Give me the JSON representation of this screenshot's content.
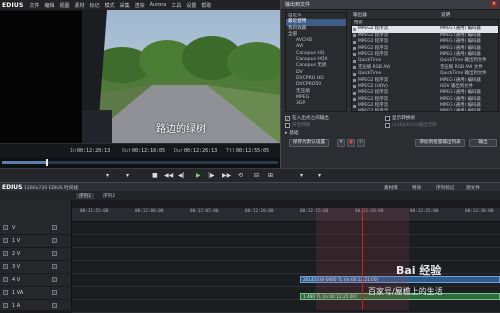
{
  "app": {
    "name": "EDIUS"
  },
  "menu": [
    "文件",
    "编辑",
    "视图",
    "素材",
    "标记",
    "模式",
    "采集",
    "渲染",
    "Aurora",
    "工具",
    "设置",
    "帮助"
  ],
  "preview": {
    "subtitle": "路边的绿树"
  },
  "timecodes": [
    {
      "label": "In",
      "value": "00:12:20:13"
    },
    {
      "label": "Out",
      "value": "00:12:16:05"
    },
    {
      "label": "Dur",
      "value": "00:12:26:13"
    },
    {
      "label": "Ttl",
      "value": "00:12:55:05"
    }
  ],
  "scrub_progress": 0.16,
  "dialog": {
    "title": "输出到文件",
    "tree": [
      "自定义",
      "最近使用",
      "我的收藏",
      "全部",
      "AVCHD",
      "AVI",
      "Canopus HQ",
      "Canopus HQX",
      "Canopus 无损",
      "DV",
      "DVCPRO HD",
      "DVCPRO50",
      "无压缩",
      "MPEG",
      "3GP"
    ],
    "tree_selected": 1,
    "col_output": "输出器",
    "col_desc": "说明",
    "search_label": "搜索",
    "rows": [
      {
        "name": "MPEG2 程序流",
        "desc": "MPEG (通用) 编码器"
      },
      {
        "name": "MPEG2 程序流",
        "desc": "MPEG (通用) 编码器"
      },
      {
        "name": "MPEG2 程序流",
        "desc": "MPEG (通用) 编码器"
      },
      {
        "name": "MPEG2 程序流",
        "desc": "MPEG (通用) 编码器"
      },
      {
        "name": "MPEG2 程序流",
        "desc": "MPEG (通用) 编码器"
      },
      {
        "name": "QuickTime",
        "desc": "QuickTime 输出到文件"
      },
      {
        "name": "无压缩 RGB AVI",
        "desc": "无压缩 RGB AVI 文件"
      },
      {
        "name": "QuickTime",
        "desc": "QuickTime 输出到文件"
      },
      {
        "name": "MPEG2 程序流",
        "desc": "MPEG (通用) 编码器"
      },
      {
        "name": "MPEG2 (HDV)",
        "desc": "HDV 输出到文件"
      },
      {
        "name": "MPEG2 程序流",
        "desc": "MPEG (通用) 编码器"
      },
      {
        "name": "MPEG2 程序流",
        "desc": "MPEG (通用) 编码器"
      },
      {
        "name": "MPEG2 程序流",
        "desc": "MPEG (通用) 编码器"
      },
      {
        "name": "MPEG2 程序流",
        "desc": "MPEG (通用) 编码器"
      }
    ],
    "row_selected": 0,
    "opt_inout": "在入出点之间输出",
    "opt_convert": "显示转换帧",
    "opt_field": "开启转换",
    "opt_reverse": "以16bit/2ch输出音频",
    "opt_basic": "基础",
    "btn_save_default": "保存为默认设置",
    "btn_add": "添加到批量输出列表",
    "btn_output": "输出"
  },
  "timeline": {
    "title": "1280x720  EDIUS 时间线",
    "tabs": [
      "序列1",
      "序列2"
    ],
    "right_tabs": [
      "素材库",
      "特效",
      "序列标记",
      "源文件"
    ],
    "ruler": [
      "00:11:55:00",
      "00:12:00:00",
      "00:12:05:00",
      "00:12:10:00",
      "00:12:15:00",
      "00:12:20:00",
      "00:12:25:00",
      "00:12:30:00"
    ],
    "tracks": [
      "V",
      "1 V",
      "2 V",
      "3 V",
      "4 V",
      "1 VA",
      "1 A"
    ],
    "clip_v": "20141030-0000  TL [In:00:12:21:00]",
    "clip_a": "1 460  TL [In:00:12:25:00]"
  },
  "watermark": "Bai 经验",
  "credit": "百家号/屋檐上的生活",
  "colors": {
    "accent": "#3b5d86",
    "playhead": "#d02020",
    "clip": "#2c5b8f"
  }
}
